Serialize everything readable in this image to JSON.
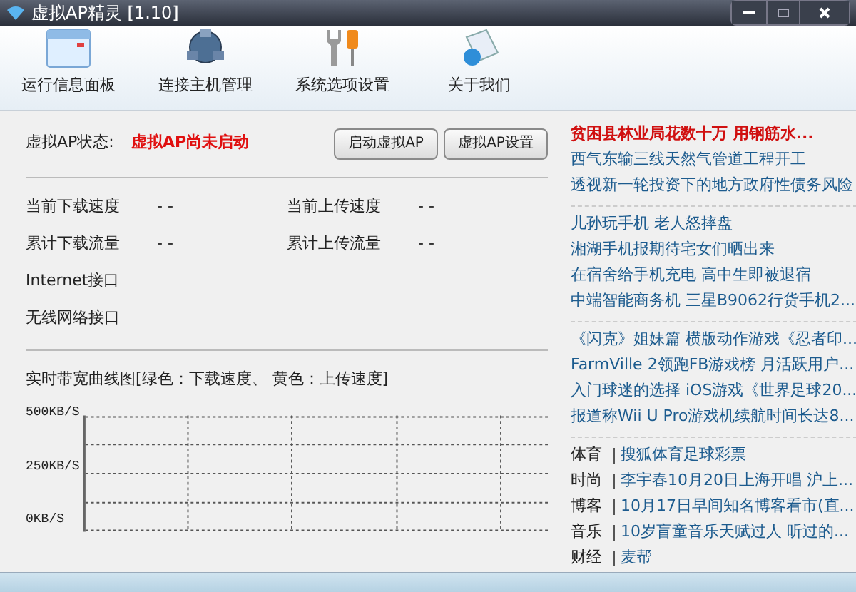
{
  "window": {
    "title": "虚拟AP精灵 [1.10]"
  },
  "toolbar": [
    {
      "label": "运行信息面板",
      "kind": "panel"
    },
    {
      "label": "连接主机管理",
      "kind": "hosts"
    },
    {
      "label": "系统选项设置",
      "kind": "tools"
    },
    {
      "label": "关于我们",
      "kind": "about"
    }
  ],
  "status": {
    "label": "虚拟AP状态:",
    "value": "虚拟AP尚未启动"
  },
  "buttons": [
    "启动虚拟AP",
    "虚拟AP设置"
  ],
  "stats": [
    {
      "label": "当前下载速度",
      "value": "- -"
    },
    {
      "label": "当前上传速度",
      "value": "- -"
    },
    {
      "label": "累计下载流量",
      "value": "- -"
    },
    {
      "label": "累计上传流量",
      "value": "- -"
    }
  ],
  "interfaces": [
    "Internet接口",
    "无线网络接口"
  ],
  "graph": {
    "title": "实时带宽曲线图[绿色：下载速度、 黄色：上传速度]",
    "ticks": [
      "500KB/S",
      "250KB/S",
      "0KB/S"
    ]
  },
  "news": [
    {
      "kind": "plain",
      "items": [
        {
          "text": "贫困县林业局花数十万 用钢筋水...",
          "headline": true
        },
        {
          "text": "西气东输三线天然气管道工程开工",
          "headline": false
        },
        {
          "text": "透视新一轮投资下的地方政府性债务风险",
          "headline": false
        }
      ]
    },
    {
      "kind": "plain",
      "items": [
        {
          "text": "儿孙玩手机 老人怒摔盘",
          "headline": false
        },
        {
          "text": "湘湖手机报期待宅女们晒出来",
          "headline": false
        },
        {
          "text": "在宿舍给手机充电 高中生即被退宿",
          "headline": false
        },
        {
          "text": "中端智能商务机 三星B9062行货手机2...",
          "headline": false
        }
      ]
    },
    {
      "kind": "plain",
      "items": [
        {
          "text": "《闪克》姐妹篇 横版动作游戏《忍者印...",
          "headline": false
        },
        {
          "text": "FarmVille 2领跑FB游戏榜 月活跃用户...",
          "headline": false
        },
        {
          "text": "入门球迷的选择 iOS游戏《世界足球20...",
          "headline": false
        },
        {
          "text": "报道称Wii U Pro游戏机续航时间长达8...",
          "headline": false
        }
      ]
    },
    {
      "kind": "category",
      "items": [
        {
          "category": "体育",
          "text": "搜狐体育足球彩票"
        },
        {
          "category": "时尚",
          "text": "李宇春10月20日上海开唱 沪上..."
        },
        {
          "category": "博客",
          "text": "10月17日早间知名博客看市(直..."
        },
        {
          "category": "音乐",
          "text": "10岁盲童音乐天赋过人 听过的..."
        },
        {
          "category": "财经",
          "text": "麦帮"
        }
      ]
    }
  ]
}
